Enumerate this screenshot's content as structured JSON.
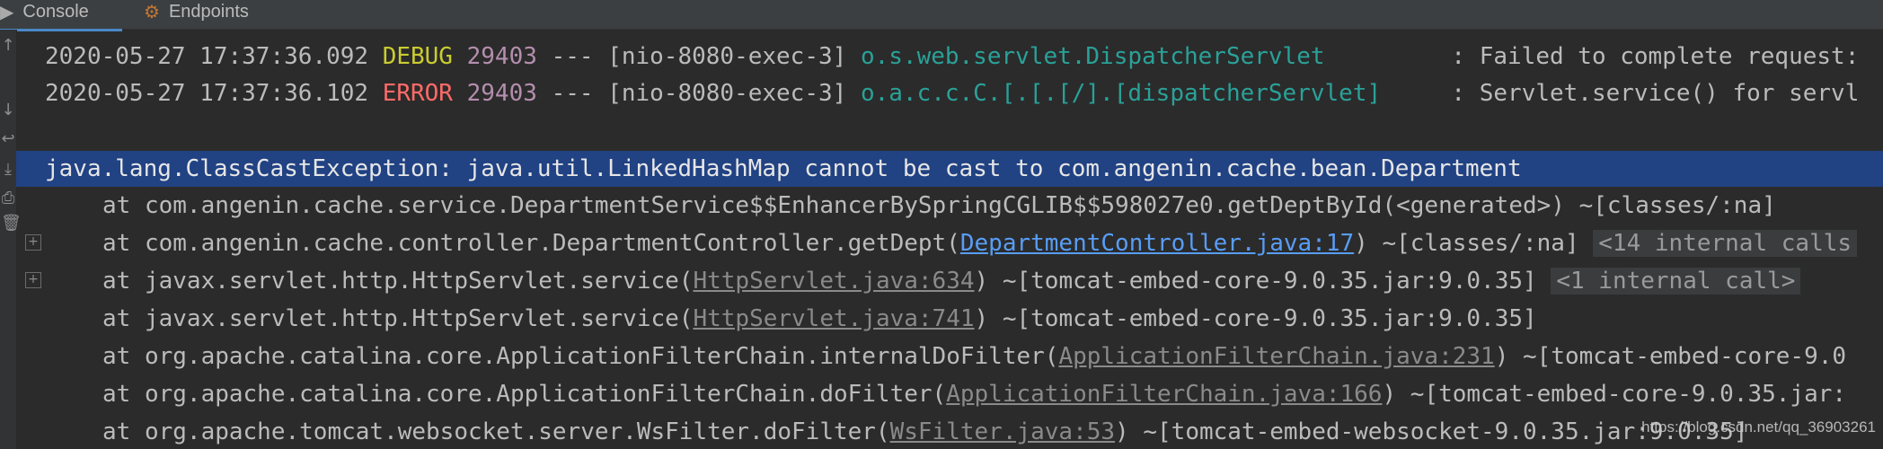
{
  "tabs": [
    {
      "label": "Console",
      "icon": "console-icon",
      "active": true
    },
    {
      "label": "Endpoints",
      "icon": "endpoints-icon",
      "active": false
    }
  ],
  "colors": {
    "background": "#2b2b2b",
    "debug": "#c9cc30",
    "error": "#ff6b68",
    "pid": "#b48ead",
    "logger": "#2aa198",
    "link": "#589df6",
    "selection": "#214283"
  },
  "log": [
    {
      "timestamp": "2020-05-27 17:37:36.092",
      "level": "DEBUG",
      "pid": "29403",
      "sep": "---",
      "thread": "[nio-8080-exec-3]",
      "logger": "o.s.web.servlet.DispatcherServlet",
      "message": ": Failed to complete request:"
    },
    {
      "timestamp": "2020-05-27 17:37:36.102",
      "level": "ERROR",
      "pid": "29403",
      "sep": "---",
      "thread": "[nio-8080-exec-3]",
      "logger": "o.a.c.c.C.[.[.[/].[dispatcherServlet]",
      "message": ": Servlet.service() for servl"
    }
  ],
  "exception": "java.lang.ClassCastException: java.util.LinkedHashMap cannot be cast to com.angenin.cache.bean.Department",
  "stack": [
    {
      "pre": "at com.angenin.cache.service.DepartmentService$$EnhancerBySpringCGLIB$$598027e0.getDeptById(<generated>) ~[classes/:na]",
      "link": "",
      "post": "",
      "internal": "",
      "fold": false
    },
    {
      "pre": "at com.angenin.cache.controller.DepartmentController.getDept(",
      "link": "DepartmentController.java:17",
      "post": ") ~[classes/:na]",
      "internal": "<14 internal calls",
      "fold": true
    },
    {
      "pre": "at javax.servlet.http.HttpServlet.service(",
      "link": "HttpServlet.java:634",
      "post": ") ~[tomcat-embed-core-9.0.35.jar:9.0.35]",
      "internal": "<1 internal call>",
      "fold": true
    },
    {
      "pre": "at javax.servlet.http.HttpServlet.service(",
      "link": "HttpServlet.java:741",
      "post": ") ~[tomcat-embed-core-9.0.35.jar:9.0.35]",
      "internal": "",
      "fold": false
    },
    {
      "pre": "at org.apache.catalina.core.ApplicationFilterChain.internalDoFilter(",
      "link": "ApplicationFilterChain.java:231",
      "post": ") ~[tomcat-embed-core-9.0",
      "internal": "",
      "fold": false
    },
    {
      "pre": "at org.apache.catalina.core.ApplicationFilterChain.doFilter(",
      "link": "ApplicationFilterChain.java:166",
      "post": ") ~[tomcat-embed-core-9.0.35.jar:",
      "internal": "",
      "fold": false
    },
    {
      "pre": "at org.apache.tomcat.websocket.server.WsFilter.doFilter(",
      "link": "WsFilter.java:53",
      "post": ") ~[tomcat-embed-websocket-9.0.35.jar:9.0.35]",
      "internal": "",
      "fold": false
    }
  ],
  "watermark": "https://blog.csdn.net/qq_36903261",
  "gutter_icons": [
    "scroll-up-icon",
    "scroll-down-icon",
    "soft-wrap-icon",
    "scroll-to-end-icon",
    "print-icon",
    "clear-icon"
  ]
}
